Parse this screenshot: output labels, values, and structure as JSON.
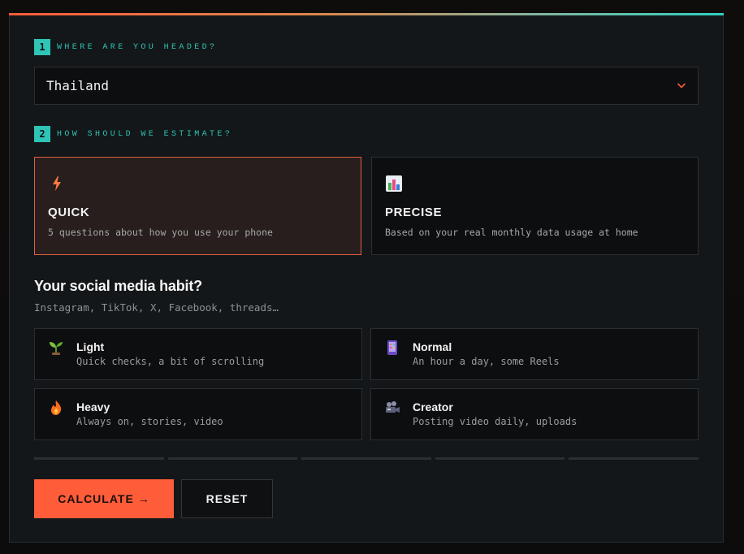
{
  "steps": [
    {
      "num": "1",
      "label": "WHERE ARE YOU HEADED?"
    },
    {
      "num": "2",
      "label": "HOW SHOULD WE ESTIMATE?"
    }
  ],
  "destination": {
    "selected": "Thailand"
  },
  "modes": [
    {
      "title": "QUICK",
      "desc": "5 questions about how you use your phone",
      "icon": "lightning-icon",
      "active": true
    },
    {
      "title": "PRECISE",
      "desc": "Based on your real monthly data usage at home",
      "icon": "bar-chart-icon",
      "active": false
    }
  ],
  "question": {
    "title": "Your social media habit?",
    "subtitle": "Instagram, TikTok, X, Facebook, threads…",
    "options": [
      {
        "title": "Light",
        "desc": "Quick checks, a bit of scrolling",
        "icon": "seedling-icon"
      },
      {
        "title": "Normal",
        "desc": "An hour a day, some Reels",
        "icon": "phone-icon"
      },
      {
        "title": "Heavy",
        "desc": "Always on, stories, video",
        "icon": "fire-icon"
      },
      {
        "title": "Creator",
        "desc": "Posting video daily, uploads",
        "icon": "movie-camera-icon"
      }
    ]
  },
  "progress": {
    "total_steps": 5,
    "completed": 0
  },
  "actions": {
    "calculate": "CALCULATE →",
    "reset": "RESET"
  },
  "colors": {
    "accent": "#ff5c3a",
    "teal": "#2ec4b6",
    "panel": "#141719"
  }
}
